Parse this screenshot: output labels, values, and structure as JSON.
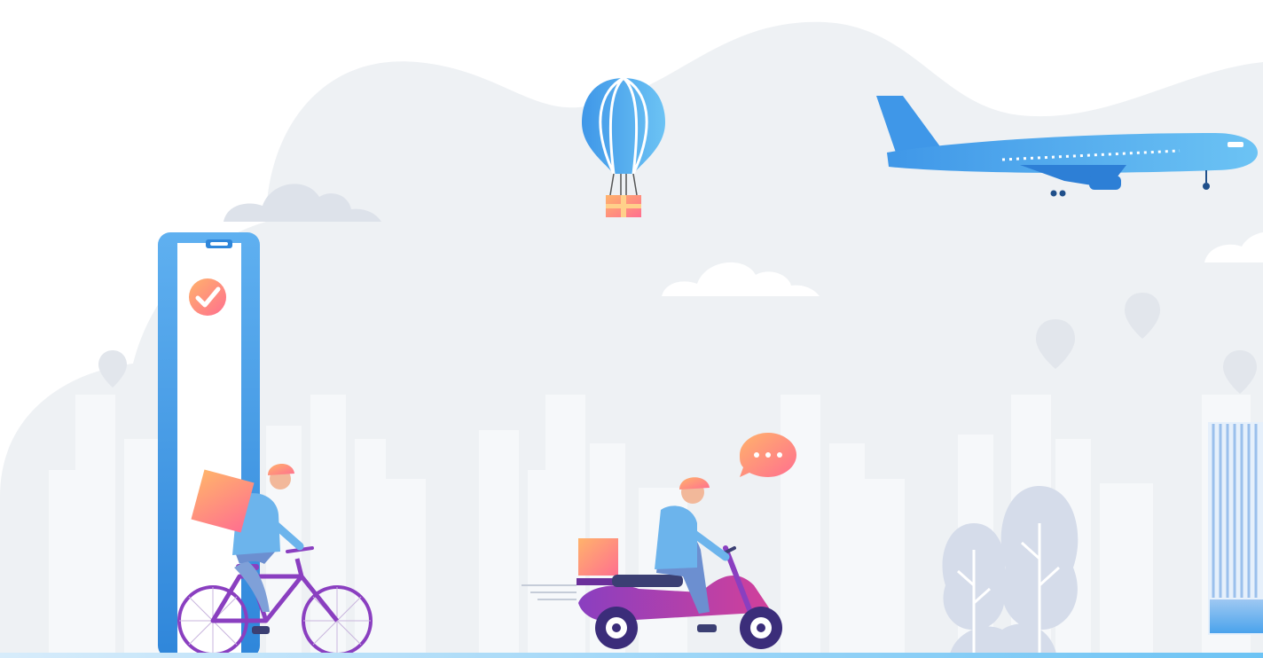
{
  "scene": {
    "description_free": true,
    "elements": {
      "phone": {
        "icon": "smartphone-icon"
      },
      "check_badge": {
        "icon": "check-circle-icon"
      },
      "balloon": {
        "icon": "hot-air-balloon-icon"
      },
      "airplane": {
        "icon": "airplane-icon"
      },
      "bicycle_courier": {
        "icon": "bicycle-courier-icon"
      },
      "scooter_courier": {
        "icon": "scooter-courier-icon"
      },
      "chat_bubble": {
        "icon": "chat-bubble-icon"
      },
      "map_pins": {
        "icon": "location-pin-icon"
      },
      "trees": {
        "icon": "tree-icon"
      },
      "building": {
        "icon": "building-icon"
      }
    },
    "colors": {
      "background": "#ffffff",
      "cloud_blob": "#eef1f4",
      "city": "#f5f7f9",
      "blue": "#4aa3ec",
      "blue_dark": "#2d7fd6",
      "orange": "#ff8a5c",
      "pink": "#ff6f9c",
      "purple": "#8a3fc0",
      "magenta": "#c0399a"
    }
  }
}
